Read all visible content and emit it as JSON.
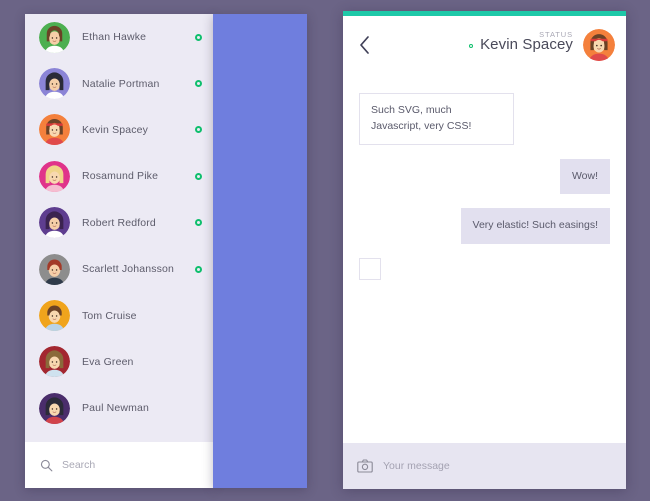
{
  "theme": {
    "background": "#6b6486",
    "card_background": "#eceaf4",
    "blue_panel": "#6f7ede",
    "accent_teal": "#1ec9a8",
    "online_green": "#0fbf6d",
    "bubble_out": "#e2e0ef",
    "text_primary": "#5d5c6b",
    "text_muted": "#a9a8b5"
  },
  "contacts_panel": {
    "contacts": [
      {
        "name": "Ethan Hawke",
        "online": true,
        "avatar": {
          "ring": "#4caf50",
          "face": "#f6cfa8",
          "hair": "#6b4226",
          "body": "#ffffff",
          "style": "hood"
        }
      },
      {
        "name": "Natalie Portman",
        "online": true,
        "avatar": {
          "ring": "#8b84d6",
          "face": "#f6cfa8",
          "hair": "#2b2b38",
          "body": "#ffffff",
          "style": "bob"
        }
      },
      {
        "name": "Kevin Spacey",
        "online": true,
        "avatar": {
          "ring": "#f4803c",
          "face": "#f8d8b0",
          "hair": "#6b4226",
          "body": "#e04a4a",
          "style": "headband"
        }
      },
      {
        "name": "Rosamund Pike",
        "online": true,
        "avatar": {
          "ring": "#e0338a",
          "face": "#f8d8b0",
          "hair": "#f0d48a",
          "body": "#f5bdd0",
          "style": "long"
        }
      },
      {
        "name": "Robert Redford",
        "online": true,
        "avatar": {
          "ring": "#5e3d8f",
          "face": "#f6cfa8",
          "hair": "#3b2350",
          "body": "#ffffff",
          "style": "bob"
        }
      },
      {
        "name": "Scarlett Johansson",
        "online": true,
        "avatar": {
          "ring": "#8d8d8d",
          "face": "#f6cfa8",
          "hair": "#a33a28",
          "body": "#2f3b4a",
          "style": "suit"
        }
      },
      {
        "name": "Tom Cruise",
        "online": false,
        "avatar": {
          "ring": "#f0a41c",
          "face": "#f8d8b0",
          "hair": "#6b4226",
          "body": "#b9d3e8",
          "style": "short"
        }
      },
      {
        "name": "Eva Green",
        "online": false,
        "avatar": {
          "ring": "#a32730",
          "face": "#f8d8b0",
          "hair": "#8a6a3a",
          "body": "#cfe2ef",
          "style": "long"
        }
      },
      {
        "name": "Paul Newman",
        "online": false,
        "avatar": {
          "ring": "#4a2d6b",
          "face": "#f8d8b0",
          "hair": "#2b2b38",
          "body": "#d1434b",
          "style": "long"
        }
      }
    ],
    "search": {
      "placeholder": "Search",
      "value": "",
      "icon": "search-icon"
    }
  },
  "chat_panel": {
    "header": {
      "back_icon": "chevron-left-icon",
      "status_label": "STATUS",
      "contact_name": "Kevin Spacey",
      "online": true,
      "avatar": {
        "ring": "#f4803c",
        "face": "#f8d8b0",
        "hair": "#6b4226",
        "body": "#e04a4a",
        "style": "headband"
      }
    },
    "messages": [
      {
        "id": "m1",
        "direction": "in",
        "text": "Such SVG, much Javascript, very CSS!"
      },
      {
        "id": "m2",
        "direction": "out",
        "text": "Wow!"
      },
      {
        "id": "m3",
        "direction": "out",
        "text": "Very elastic! Such easings!"
      },
      {
        "id": "m4",
        "direction": "in",
        "text": ""
      }
    ],
    "composer": {
      "camera_icon": "camera-icon",
      "placeholder": "Your message",
      "value": ""
    }
  }
}
